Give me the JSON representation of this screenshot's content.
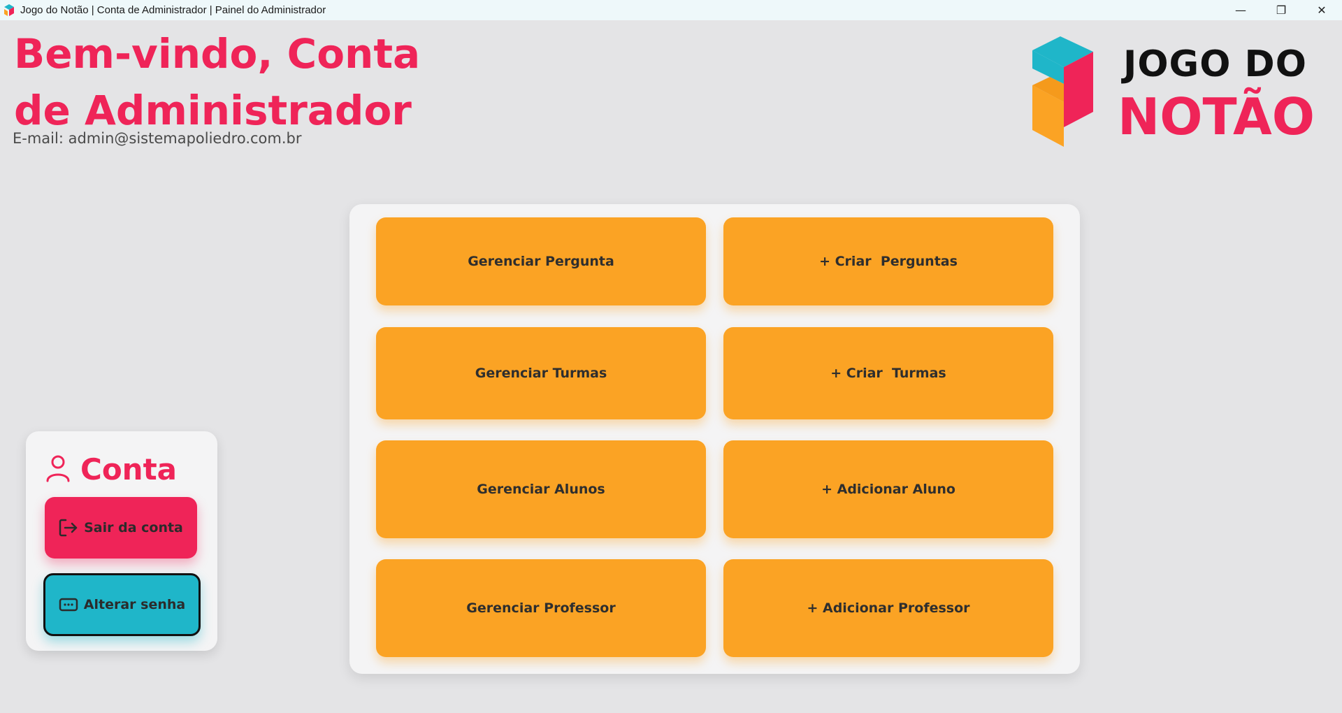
{
  "window": {
    "title": "Jogo do Notão | Conta de Administrador | Painel do Administrador",
    "minimize_glyph": "—",
    "restore_glyph": "❐",
    "close_glyph": "✕"
  },
  "header": {
    "welcome": "Bem-vindo, Conta de Administrador",
    "email": "E-mail: admin@sistemapoliedro.com.br"
  },
  "logo": {
    "line1": "JOGO DO",
    "line2": "NOTÃO"
  },
  "account": {
    "heading": "Conta",
    "logout_label": "Sair da conta",
    "change_password_label": "Alterar senha"
  },
  "actions": [
    {
      "label": "Gerenciar Pergunta"
    },
    {
      "label": "+ Criar  Perguntas"
    },
    {
      "label": "Gerenciar Turmas"
    },
    {
      "label": "+ Criar  Turmas"
    },
    {
      "label": "Gerenciar Alunos"
    },
    {
      "label": "+ Adicionar Aluno"
    },
    {
      "label": "Gerenciar Professor"
    },
    {
      "label": "+ Adicionar Professor"
    }
  ],
  "colors": {
    "brand_pink": "#ef2458",
    "brand_teal": "#1fb6c9",
    "brand_orange": "#fba324",
    "background": "#e4e4e6"
  }
}
